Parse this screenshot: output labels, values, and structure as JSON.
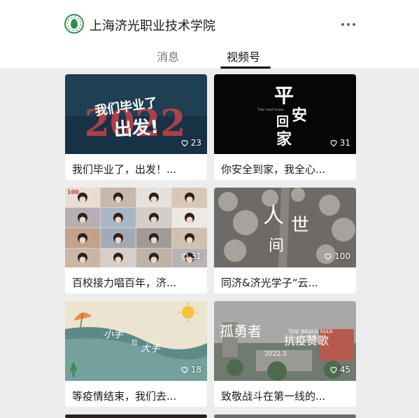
{
  "header": {
    "account_name": "上海济光职业技术学院",
    "tabs": [
      "消息",
      "视频号"
    ]
  },
  "videos": [
    {
      "likes": "23",
      "caption": "我们毕业了，出发！...",
      "thumb_lines": [
        "我们毕业了",
        "2022",
        "出发!"
      ]
    },
    {
      "likes": "31",
      "caption": "你安全到家，我全心...",
      "thumb_lines": [
        "平",
        "安",
        "回",
        "家",
        "The road home"
      ]
    },
    {
      "likes": "31",
      "caption": "百校接力唱百年，济...",
      "thumb_lines": [
        "100"
      ]
    },
    {
      "likes": "100",
      "caption": "同济&济光学子“云...",
      "thumb_lines": [
        "人",
        "世",
        "间"
      ]
    },
    {
      "likes": "18",
      "caption": "等疫情结束，我们去...",
      "thumb_lines": [
        "小手",
        "拉",
        "大手"
      ]
    },
    {
      "likes": "45",
      "caption": "致敬战斗在第一线的...",
      "thumb_lines": [
        "孤勇者",
        "THE BRAVE MAN",
        "抗疫赞歌",
        "2022.3"
      ]
    }
  ],
  "colors": {
    "background": "#ededed",
    "card": "#ffffff",
    "text": "#1a1a1a",
    "logo_green": "#2f8f4a"
  },
  "icons": {
    "like": "heart-outline-icon",
    "more": "more-dots-icon",
    "logo": "school-logo"
  }
}
